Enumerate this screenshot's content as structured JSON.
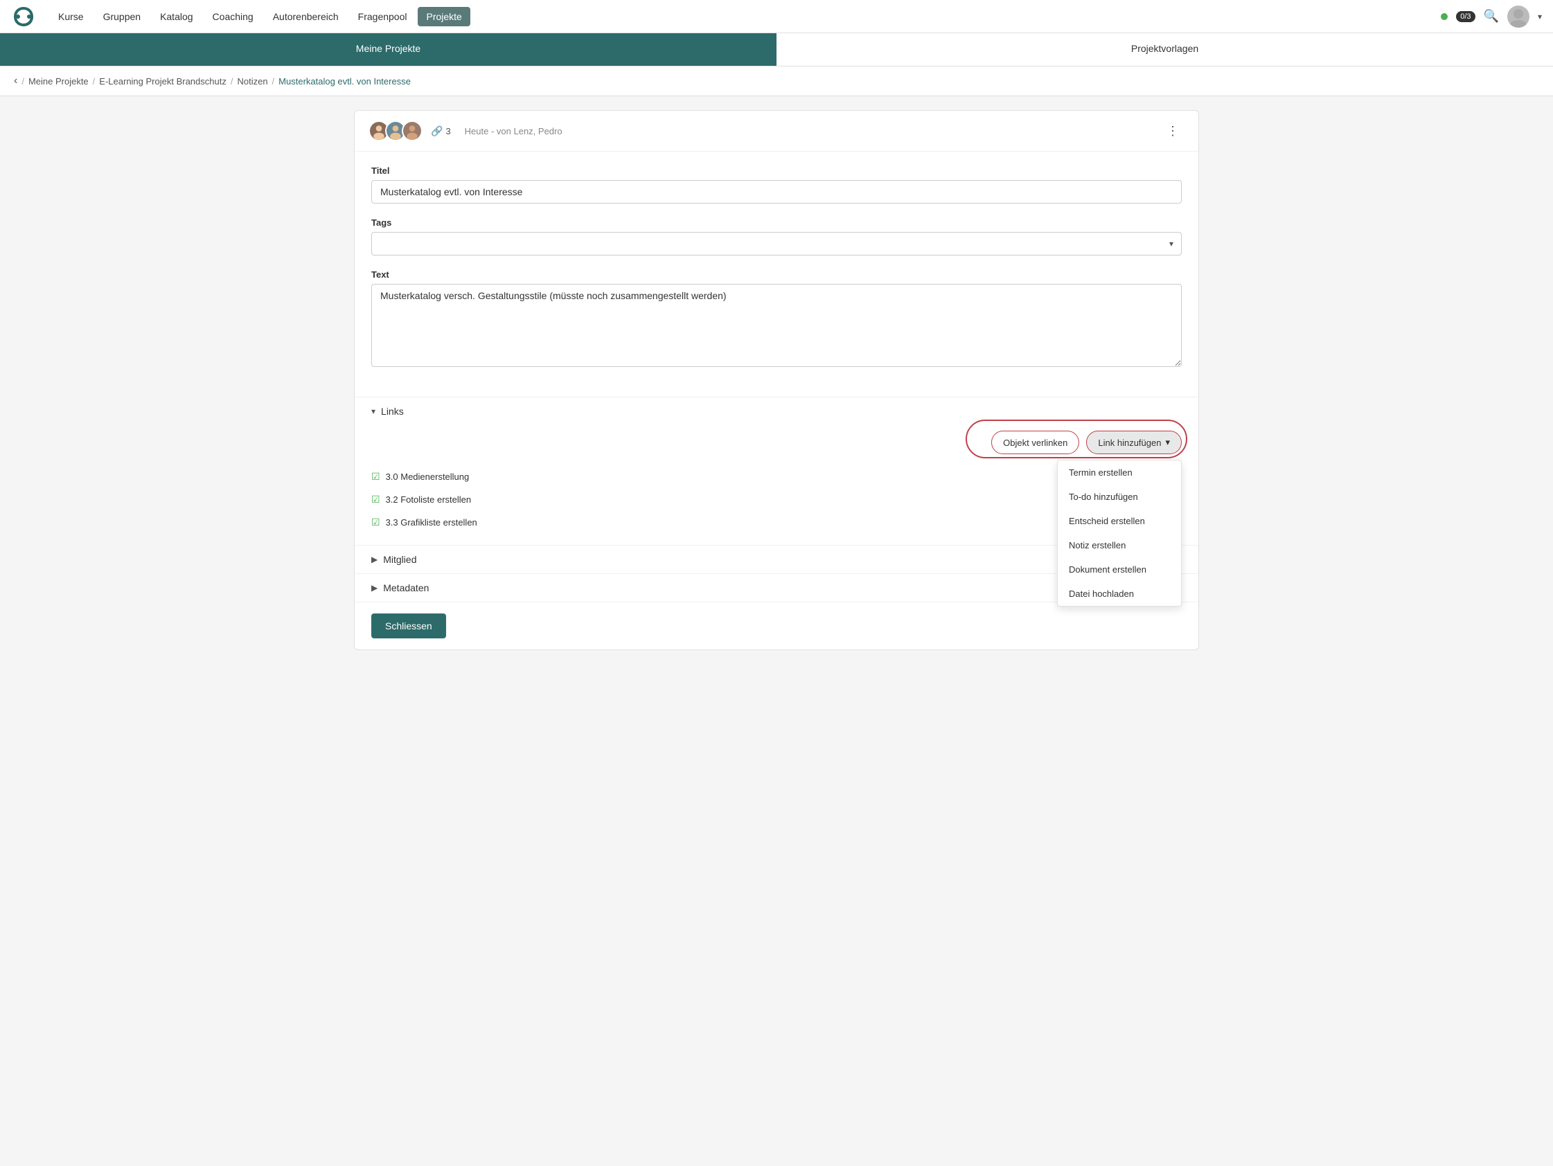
{
  "navbar": {
    "links": [
      {
        "id": "kurse",
        "label": "Kurse",
        "active": false
      },
      {
        "id": "gruppen",
        "label": "Gruppen",
        "active": false
      },
      {
        "id": "katalog",
        "label": "Katalog",
        "active": false
      },
      {
        "id": "coaching",
        "label": "Coaching",
        "active": false
      },
      {
        "id": "autorenbereich",
        "label": "Autorenbereich",
        "active": false
      },
      {
        "id": "fragenpool",
        "label": "Fragenpool",
        "active": false
      },
      {
        "id": "projekte",
        "label": "Projekte",
        "active": true
      }
    ],
    "badge": "0/3",
    "search_icon": "🔍",
    "chevron": "▾"
  },
  "tabs": [
    {
      "id": "meine-projekte",
      "label": "Meine Projekte",
      "active": true
    },
    {
      "id": "projektvorlagen",
      "label": "Projektvorlagen",
      "active": false
    }
  ],
  "breadcrumb": {
    "back_icon": "‹",
    "items": [
      {
        "label": "Meine Projekte",
        "current": false
      },
      {
        "label": "E-Learning Projekt Brandschutz",
        "current": false
      },
      {
        "label": "Notizen",
        "current": false
      },
      {
        "label": "Musterkatalog evtl. von Interesse",
        "current": true
      }
    ]
  },
  "card": {
    "link_count": "3",
    "meta": "Heute - von Lenz, Pedro",
    "menu_icon": "⋮"
  },
  "form": {
    "title_label": "Titel",
    "title_value": "Musterkatalog evtl. von Interesse",
    "tags_label": "Tags",
    "tags_placeholder": "",
    "text_label": "Text",
    "text_value": "Musterkatalog versch. Gestaltungsstile (müsste noch zusammengestellt werden)"
  },
  "links_section": {
    "label": "Links",
    "arrow": "▾",
    "btn_objekt": "Objekt verlinken",
    "btn_link": "Link hinzufügen",
    "btn_dropdown_arrow": "▾",
    "dropdown_items": [
      {
        "label": "Termin erstellen"
      },
      {
        "label": "To-do hinzufügen"
      },
      {
        "label": "Entscheid erstellen"
      },
      {
        "label": "Notiz erstellen"
      },
      {
        "label": "Dokument erstellen"
      },
      {
        "label": "Datei hochladen"
      }
    ],
    "link_items": [
      {
        "icon": "☑",
        "text": "3.0 Medienerstellung"
      },
      {
        "icon": "☑",
        "text": "3.2 Fotoliste erstellen"
      },
      {
        "icon": "☑",
        "text": "3.3 Grafikliste erstellen"
      }
    ]
  },
  "mitglied_section": {
    "label": "Mitglied",
    "arrow": "▶"
  },
  "metadaten_section": {
    "label": "Metadaten",
    "arrow": "▶"
  },
  "close_btn": "Schliessen"
}
